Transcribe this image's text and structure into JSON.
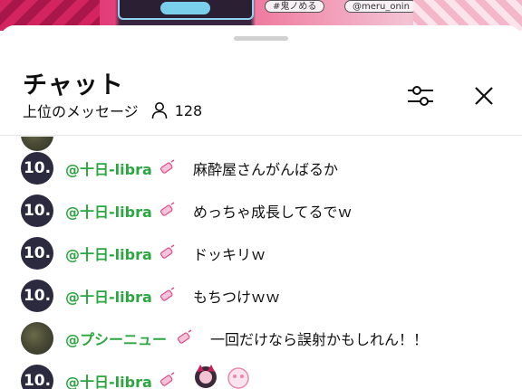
{
  "banner": {
    "tags": [
      "#鬼ノめる",
      "@meru_onin"
    ]
  },
  "chat": {
    "title": "チャット",
    "mode_label": "上位のメッセージ",
    "viewer_count": "128",
    "filter_icon": "sliders-icon",
    "close_icon": "close-icon",
    "user_icon": "person-icon"
  },
  "messages": [
    {
      "avatar_text": "",
      "author": "",
      "text": ""
    },
    {
      "avatar_text": "10.",
      "author": "@十日-libra",
      "text": "麻酔屋さんがんばるか"
    },
    {
      "avatar_text": "10.",
      "author": "@十日-libra",
      "text": "めっちゃ成長してるでｗ"
    },
    {
      "avatar_text": "10.",
      "author": "@十日-libra",
      "text": "ドッキリｗ"
    },
    {
      "avatar_text": "10.",
      "author": "@十日-libra",
      "text": "もちつけｗｗ"
    },
    {
      "avatar_text": "",
      "author": "@プシーニュー",
      "text": "一回だけなら誤射かもしれん！！"
    },
    {
      "avatar_text": "10.",
      "author": "@十日-libra",
      "text": ""
    }
  ],
  "colors": {
    "author": "#2ba640",
    "badge": "#e04a8c",
    "avatar_bg": "#2c2a3f"
  }
}
